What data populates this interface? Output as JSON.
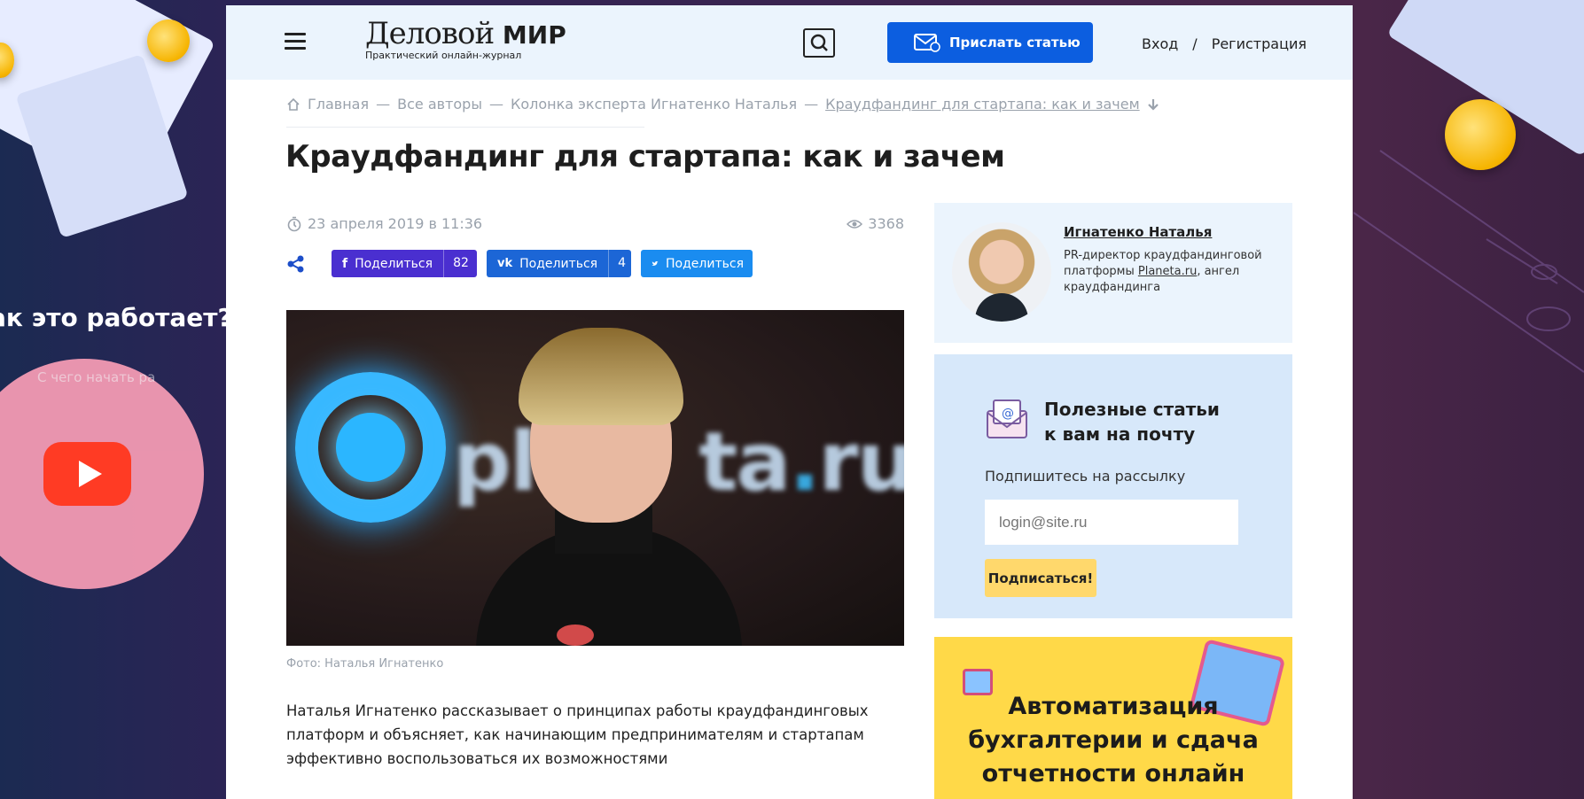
{
  "background": {
    "promo_title": "ак это работает?",
    "promo_ghost_text": "С чего начать ра"
  },
  "header": {
    "logo_title_prefix": "Деловой",
    "logo_title_suffix": "МИР",
    "logo_subtitle": "Практический онлайн-журнал",
    "send_article_label": "Прислать статью",
    "login_label": "Вход",
    "auth_separator": "/",
    "register_label": "Регистрация"
  },
  "breadcrumbs": {
    "items": [
      "Главная",
      "Все авторы",
      "Колонка эксперта Игнатенко Наталья"
    ],
    "separator": "—",
    "current": "Краудфандинг для стартапа: как и зачем"
  },
  "article": {
    "title": "Краудфандинг для стартапа: как и зачем",
    "date": "23 апреля 2019 в 11:36",
    "views": "3368",
    "photo_caption": "Фото: Наталья Игнатенко",
    "lead": "Наталья Игнатенко рассказывает о принципах работы краудфандинговых платформ и объясняет, как начинающим предпринимателям и стартапам эффективно воспользоваться их возможностями"
  },
  "share": {
    "facebook": {
      "label": "Поделиться",
      "count": "82"
    },
    "vk": {
      "label": "Поделиться",
      "count": "4"
    },
    "twitter": {
      "label": "Поделиться"
    }
  },
  "photo": {
    "sign_text_a": "pl",
    "sign_text_b": "ta",
    "sign_text_c": ".",
    "sign_text_d": "ru"
  },
  "author": {
    "name": "Игнатенко Наталья",
    "desc_before": "PR-директор краудфандинговой платформы ",
    "desc_link": "Planeta.ru",
    "desc_after": ", ангел краудфандинга"
  },
  "subscribe": {
    "title_line1": "Полезные статьи",
    "title_line2": "к вам на почту",
    "label": "Подпишитесь на рассылку",
    "input_placeholder": "login@site.ru",
    "button_label": "Подписаться!"
  },
  "ad": {
    "line1": "Автоматизация",
    "line2": "бухгалтерии и сдача",
    "line3": "отчетности онлайн"
  },
  "colors": {
    "accent_blue": "#0c5ee0",
    "facebook": "#4a2fd0",
    "vk": "#1c66d6",
    "twitter": "#1a8cf0",
    "subscribe_button": "#ffd86c",
    "ad_background": "#ffd948"
  }
}
